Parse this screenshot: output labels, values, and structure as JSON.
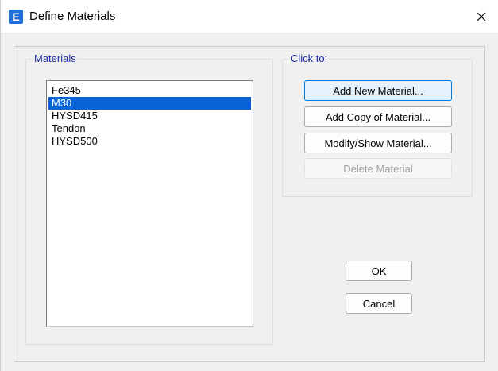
{
  "window": {
    "title": "Define Materials",
    "app_icon_letter": "E"
  },
  "materials": {
    "group_label": "Materials",
    "items": [
      "Fe345",
      "M30",
      "HYSD415",
      "Tendon",
      "HYSD500"
    ],
    "selected": "M30"
  },
  "actions": {
    "group_label": "Click to:",
    "add_new": "Add New Material...",
    "add_copy": "Add Copy of Material...",
    "modify_show": "Modify/Show Material...",
    "delete": "Delete Material"
  },
  "dialog": {
    "ok": "OK",
    "cancel": "Cancel"
  },
  "colors": {
    "selection": "#0a64d8",
    "group_label": "#1c2aa0",
    "app_icon": "#1e6fd9",
    "default_button_border": "#0078d7"
  },
  "icons": {
    "app": "etabs-app-icon",
    "close": "close-icon"
  }
}
